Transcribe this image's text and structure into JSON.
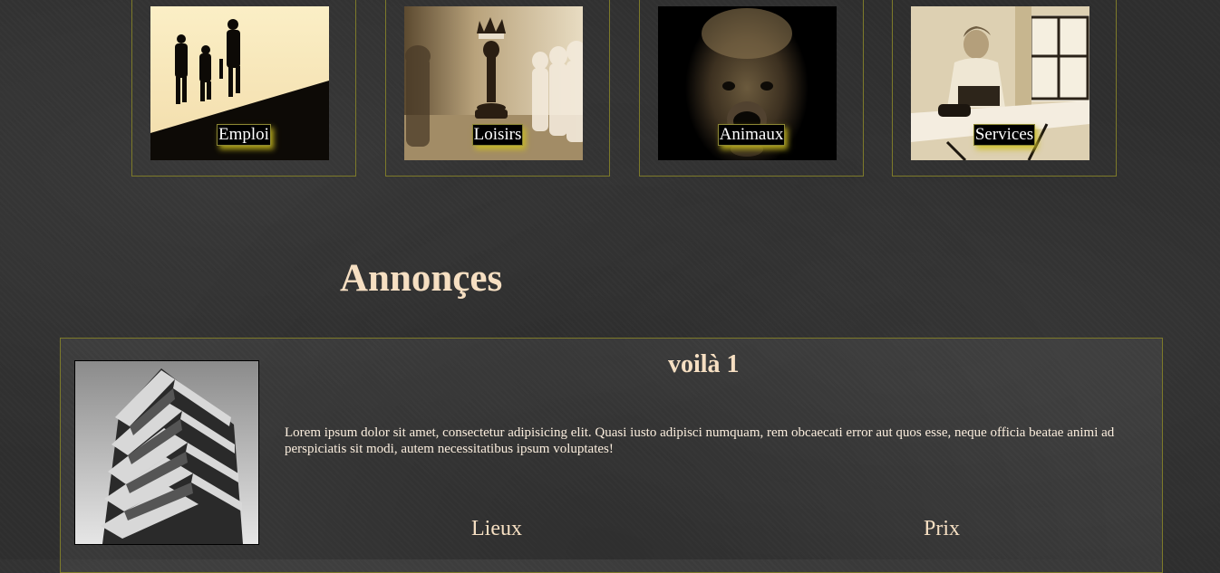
{
  "categories": [
    {
      "label": "Emploi",
      "icon": "workers-silhouette-image"
    },
    {
      "label": "Loisirs",
      "icon": "chess-pieces-image"
    },
    {
      "label": "Animaux",
      "icon": "dog-portrait-image"
    },
    {
      "label": "Services",
      "icon": "woman-ironing-image"
    }
  ],
  "annonces": {
    "heading": "Annonçes",
    "items": [
      {
        "title": "voilà 1",
        "description": "Lorem ipsum dolor sit amet, consectetur adipisicing elit. Quasi iusto adipisci numquam, rem obcaecati error aut quos esse, neque officia beatae animi ad perspiciatis sit modi, autem necessitatibus ipsum voluptates!",
        "lieux_label": "Lieux",
        "prix_label": "Prix",
        "image": "building-photo-image"
      }
    ]
  },
  "colors": {
    "background": "#2f2f2f",
    "card_border": "#7d7a2a",
    "heading_text": "#f6dfc2",
    "label_glow": "#cdbe1e"
  }
}
